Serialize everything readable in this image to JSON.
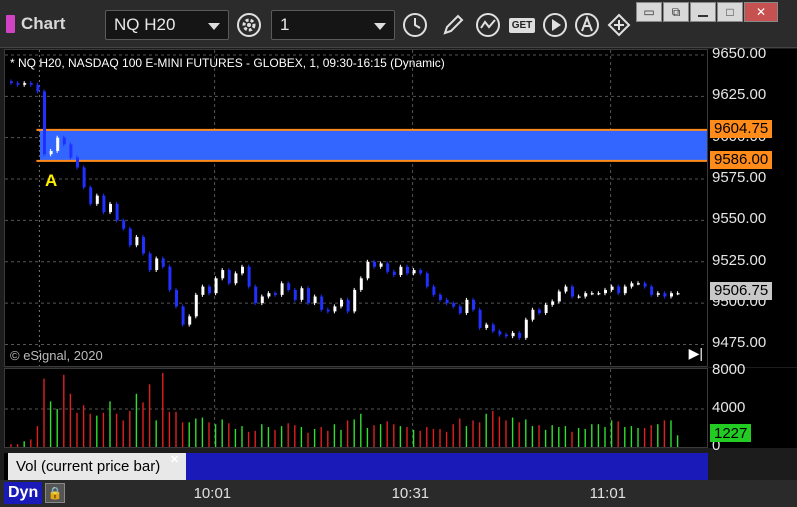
{
  "window": {
    "title": "Chart"
  },
  "toolbar": {
    "symbol": "NQ H20",
    "interval": "1",
    "icons": [
      "gear-icon",
      "clock-icon",
      "pencil-icon",
      "line-study-icon",
      "get-icon",
      "play-icon",
      "cursor-icon",
      "pan-icon"
    ],
    "get_label": "GET"
  },
  "window_controls": {
    "restore": "▭",
    "detach": "⧉",
    "maximize": "□",
    "close": "✕"
  },
  "chart_title": "* NQ H20, NASDAQ 100 E-MINI FUTURES - GLOBEX, 1, 09:30-16:15 (Dynamic)",
  "watermark": "© eSignal, 2020",
  "annotation": "A",
  "legend": "Vol (current price bar)",
  "dyn_label": "Dyn",
  "colors": {
    "up": "#ffffff",
    "down": "#2030ff",
    "band": "#3366ff",
    "band_line": "#ff8c1a",
    "vol_up": "#2ee02e",
    "vol_down": "#e02020",
    "last_tag": "#c8c8c8",
    "vol_tag": "#22cc22"
  },
  "chart_data": [
    {
      "type": "candlestick",
      "y_ticks": [
        "9650.00",
        "9625.00",
        "9600.00",
        "9575.00",
        "9550.00",
        "9525.00",
        "9500.00",
        "9475.00"
      ],
      "ylim": [
        9462,
        9653
      ],
      "x_ticks": [
        "10:01",
        "10:31",
        "11:01"
      ],
      "x_tick_index": [
        31,
        61,
        91
      ],
      "band": {
        "high": 9604.75,
        "low": 9586.0
      },
      "band_labels": [
        "9604.75",
        "9586.00"
      ],
      "last_price_label": "9506.75",
      "close": [
        9633,
        9632,
        9633,
        9632,
        9628,
        9590,
        9592,
        9600,
        9596,
        9588,
        9582,
        9570,
        9560,
        9565,
        9555,
        9560,
        9550,
        9545,
        9535,
        9540,
        9530,
        9520,
        9527,
        9522,
        9508,
        9498,
        9487,
        9492,
        9505,
        9510,
        9506,
        9515,
        9520,
        9512,
        9518,
        9522,
        9510,
        9500,
        9504,
        9506,
        9505,
        9512,
        9508,
        9502,
        9509,
        9500,
        9504,
        9496,
        9495,
        9498,
        9502,
        9495,
        9508,
        9515,
        9525,
        9522,
        9524,
        9519,
        9517,
        9522,
        9518,
        9520,
        9518,
        9510,
        9505,
        9502,
        9500,
        9498,
        9494,
        9502,
        9496,
        9485,
        9487,
        9483,
        9481,
        9480,
        9482,
        9479,
        9490,
        9496,
        9494,
        9499,
        9501,
        9507,
        9510,
        9504,
        9504,
        9506,
        9506,
        9506,
        9508,
        9510,
        9506,
        9510,
        9512,
        9512,
        9510,
        9505,
        9506,
        9504,
        9506,
        9506
      ],
      "volume": [
        300,
        300,
        600,
        800,
        2200,
        7200,
        4800,
        4000,
        7600,
        5600,
        3600,
        4400,
        3500,
        3300,
        3600,
        4800,
        3500,
        2800,
        3800,
        5600,
        4700,
        6600,
        2800,
        7800,
        3700,
        3700,
        2600,
        2600,
        3000,
        3100,
        2600,
        2400,
        2900,
        2500,
        1900,
        2200,
        1600,
        1700,
        2400,
        2100,
        1800,
        2200,
        2500,
        2300,
        2100,
        1500,
        1900,
        2100,
        1700,
        2400,
        1800,
        2800,
        2900,
        3500,
        2000,
        2300,
        2400,
        2700,
        2400,
        2200,
        2100,
        1800,
        1700,
        2100,
        1900,
        1900,
        1600,
        2400,
        3000,
        2200,
        2800,
        2600,
        3500,
        3800,
        3200,
        2800,
        3100,
        2600,
        2900,
        2200,
        2300,
        1800,
        2300,
        2100,
        2200,
        1600,
        2000,
        1900,
        2400,
        2400,
        2100,
        2800,
        2700,
        2100,
        2200,
        2000,
        2000,
        2300,
        2400,
        2800,
        2800,
        1227
      ],
      "volume_ticks": [
        "8000",
        "4000",
        "0"
      ],
      "vlim": [
        0,
        8000
      ],
      "volume_last_label": "1227"
    }
  ]
}
